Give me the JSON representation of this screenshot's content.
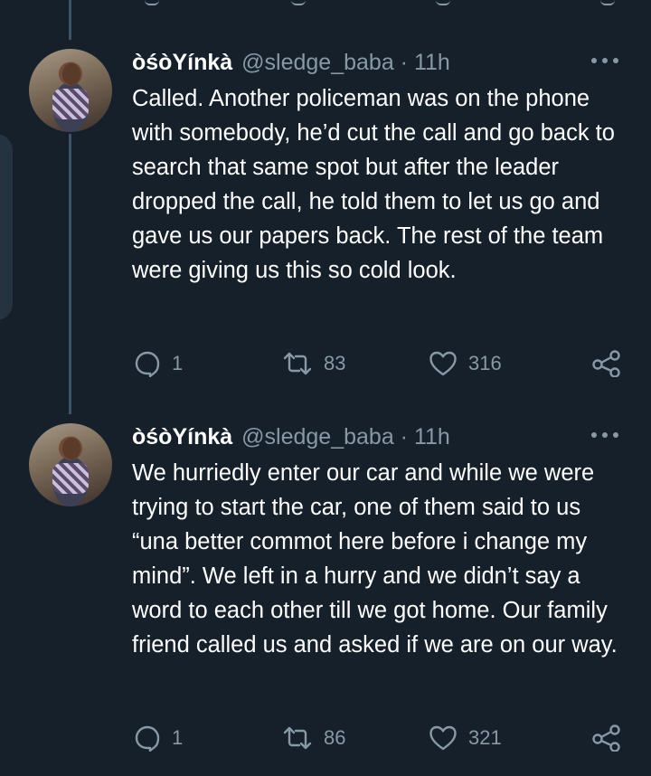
{
  "colors": {
    "background": "#15202b",
    "secondary_text": "#8899a6",
    "thread_line": "#3d5466"
  },
  "tweets": [
    {
      "name": "òśòYínkà",
      "handle_line": "@sledge_baba · 11h",
      "text": "Called. Another policeman was on the phone with somebody, he’d cut the call and go back to search that same spot but after the leader dropped the call, he told them to let us go and gave us our papers back. The rest of the team were giving us this so cold look.",
      "replies": "1",
      "retweets": "83",
      "likes": "316"
    },
    {
      "name": "òśòYínkà",
      "handle_line": "@sledge_baba · 11h",
      "text": "We hurriedly enter our car and while we were trying to start the car, one of them said to us “una better commot here before i change my mind”. We left in a hurry and we didn’t say a word to each other till we got home. Our family friend called us and asked if we are on our way.",
      "replies": "1",
      "retweets": "86",
      "likes": "321"
    }
  ],
  "icons": {
    "reply": "reply-bubble-icon",
    "retweet": "retweet-icon",
    "like": "heart-icon",
    "share": "share-icon",
    "more": "more-dots-icon"
  }
}
